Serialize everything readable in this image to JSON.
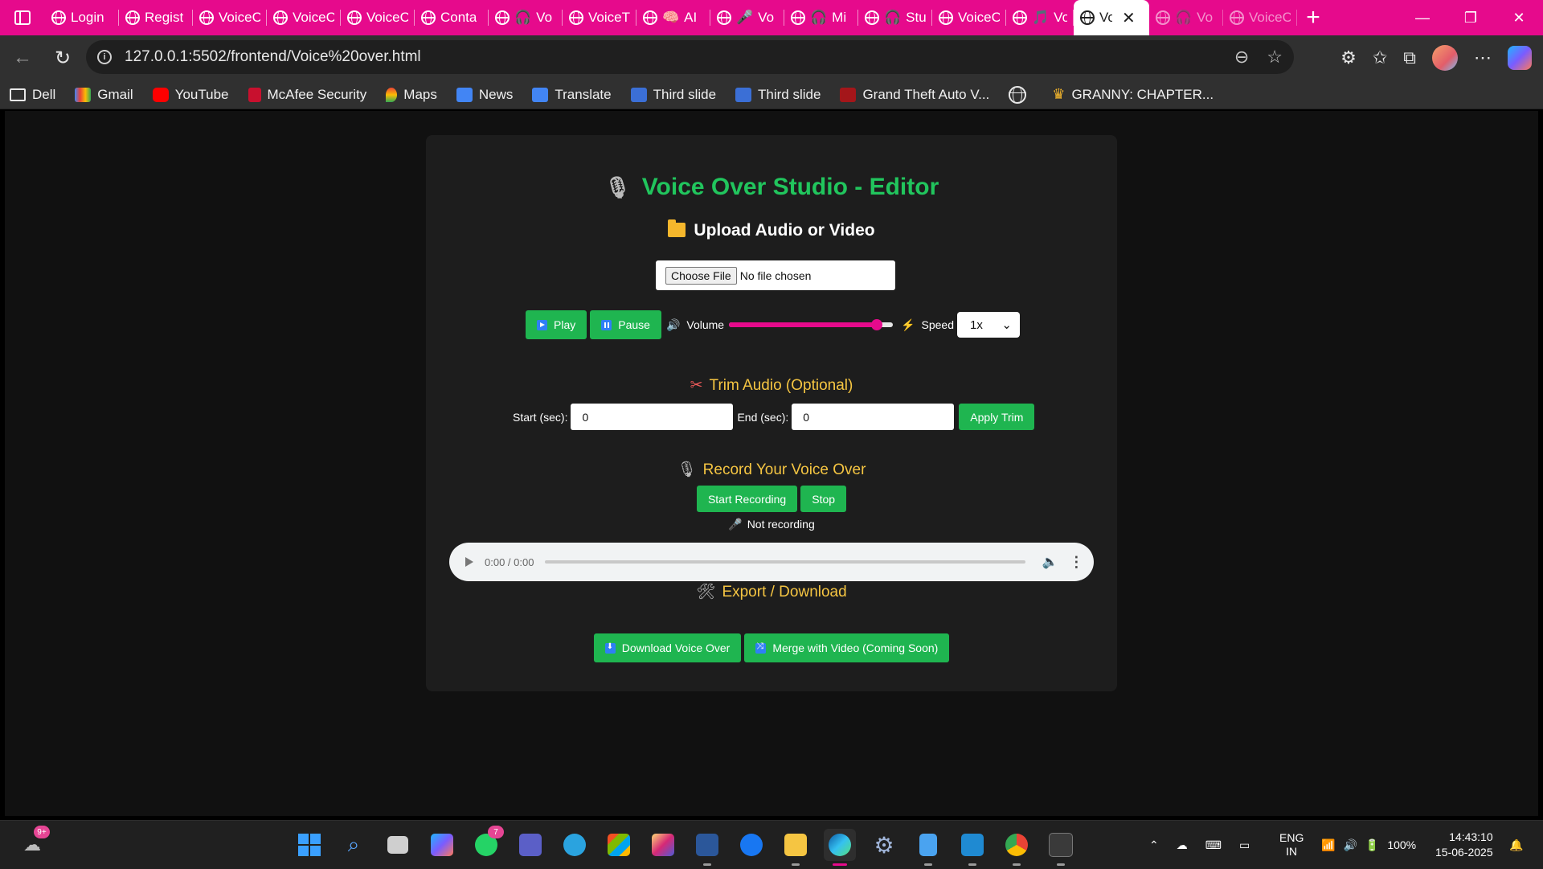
{
  "browser": {
    "tabs": [
      {
        "label": "Login"
      },
      {
        "label": "Regist"
      },
      {
        "label": "VoiceC"
      },
      {
        "label": "VoiceC"
      },
      {
        "label": "VoiceC"
      },
      {
        "label": "Conta"
      },
      {
        "label": "Vo"
      },
      {
        "label": "VoiceT"
      },
      {
        "label": "AI"
      },
      {
        "label": "Vo"
      },
      {
        "label": "Mi"
      },
      {
        "label": "Stu"
      },
      {
        "label": "VoiceC"
      },
      {
        "label": "Vo"
      },
      {
        "label": "Vo"
      },
      {
        "label": "Vo"
      },
      {
        "label": "VoiceC"
      }
    ],
    "address": "127.0.0.1:5502/frontend/Voice%20over.html",
    "accent_color": "#e60a8c",
    "bookmarks": [
      {
        "label": "Dell",
        "icon": "folder-icon"
      },
      {
        "label": "Gmail",
        "icon": "gmail-icon"
      },
      {
        "label": "YouTube",
        "icon": "youtube-icon"
      },
      {
        "label": "McAfee Security",
        "icon": "mcafee-icon"
      },
      {
        "label": "Maps",
        "icon": "maps-icon"
      },
      {
        "label": "News",
        "icon": "news-icon"
      },
      {
        "label": "Translate",
        "icon": "translate-icon"
      },
      {
        "label": "Third slide",
        "icon": "bootstrap-icon"
      },
      {
        "label": "Third slide",
        "icon": "bootstrap-icon"
      },
      {
        "label": "Grand Theft Auto V...",
        "icon": "gta-icon"
      },
      {
        "label": "",
        "icon": "globe-icon"
      },
      {
        "label": "GRANNY: CHAPTER...",
        "icon": "crown-icon"
      }
    ]
  },
  "page": {
    "title": "Voice Over Studio - Editor",
    "upload": {
      "heading": "Upload Audio or Video",
      "choose_label": "Choose File",
      "file_status": "No file chosen"
    },
    "player": {
      "play_label": "Play",
      "pause_label": "Pause",
      "volume_label": "Volume",
      "volume_level": 0.9,
      "speed_label": "Speed",
      "speed_value": "1x"
    },
    "trim": {
      "heading": "Trim Audio (Optional)",
      "start_label": "Start (sec):",
      "start_value": "0",
      "end_label": "End (sec):",
      "end_value": "0",
      "apply_label": "Apply Trim"
    },
    "record": {
      "heading": "Record Your Voice Over",
      "start_label": "Start Recording",
      "stop_label": "Stop",
      "status": "Not recording"
    },
    "audio_player": {
      "time": "0:00 / 0:00"
    },
    "export": {
      "heading": "Export / Download",
      "download_label": "Download Voice Over",
      "merge_label": "Merge with Video (Coming Soon)"
    },
    "colors": {
      "title_green": "#21c55d",
      "button_green": "#1fb550",
      "section_yellow": "#f5c542"
    }
  },
  "taskbar": {
    "weather_badge": "9+",
    "whatsapp_badge": "7",
    "lang_top": "ENG",
    "lang_bottom": "IN",
    "battery": "100%",
    "time": "14:43:10",
    "date": "15-06-2025"
  }
}
